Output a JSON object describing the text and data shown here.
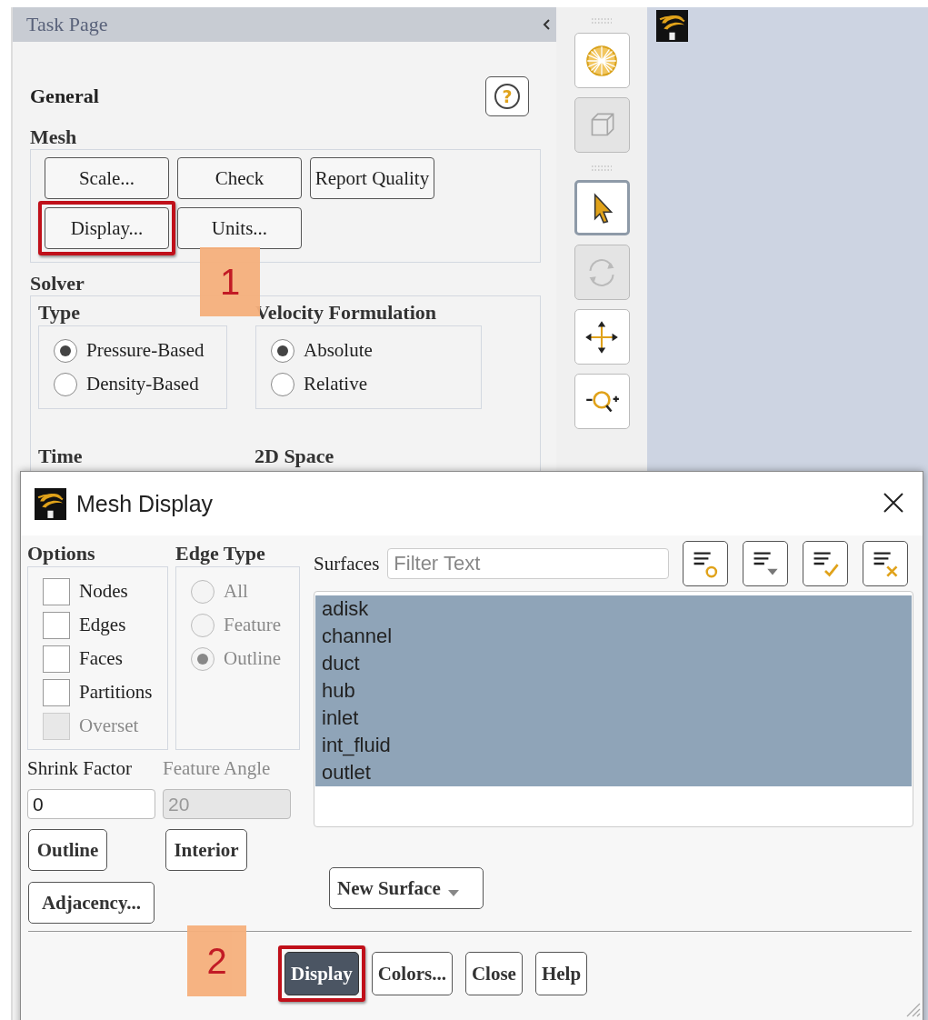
{
  "task_page": {
    "title": "Task Page",
    "heading": "General",
    "help_glyph": "?",
    "mesh": {
      "label": "Mesh",
      "buttons": [
        {
          "label": "Scale...",
          "highlighted": false
        },
        {
          "label": "Check",
          "highlighted": false
        },
        {
          "label": "Report Quality",
          "highlighted": false
        },
        {
          "label": "Display...",
          "highlighted": true
        },
        {
          "label": "Units...",
          "highlighted": false
        }
      ]
    },
    "solver": {
      "label": "Solver",
      "groups": [
        {
          "label": "Type",
          "options": [
            {
              "label": "Pressure-Based",
              "selected": true
            },
            {
              "label": "Density-Based",
              "selected": false
            }
          ]
        },
        {
          "label": "Velocity Formulation",
          "options": [
            {
              "label": "Absolute",
              "selected": true
            },
            {
              "label": "Relative",
              "selected": false
            }
          ]
        }
      ]
    },
    "cut_labels": [
      "Time",
      "2D Space"
    ]
  },
  "toolbar": [
    {
      "kind": "grip"
    },
    {
      "kind": "sphere",
      "disabled": false,
      "selected": false
    },
    {
      "kind": "cube",
      "disabled": true,
      "selected": false
    },
    {
      "kind": "grip"
    },
    {
      "kind": "pointer",
      "disabled": false,
      "selected": true
    },
    {
      "kind": "rotate",
      "disabled": true,
      "selected": false
    },
    {
      "kind": "move",
      "disabled": false,
      "selected": false
    },
    {
      "kind": "zoom",
      "disabled": false,
      "selected": false
    }
  ],
  "dialog": {
    "title": "Mesh Display",
    "options": {
      "label": "Options",
      "items": [
        {
          "label": "Nodes",
          "checked": false,
          "disabled": false
        },
        {
          "label": "Edges",
          "checked": false,
          "disabled": false
        },
        {
          "label": "Faces",
          "checked": false,
          "disabled": false
        },
        {
          "label": "Partitions",
          "checked": false,
          "disabled": false
        },
        {
          "label": "Overset",
          "checked": false,
          "disabled": true
        }
      ]
    },
    "edge_type": {
      "label": "Edge Type",
      "items": [
        {
          "label": "All",
          "selected": false,
          "disabled": true
        },
        {
          "label": "Feature",
          "selected": false,
          "disabled": true
        },
        {
          "label": "Outline",
          "selected": true,
          "disabled": true
        }
      ]
    },
    "fields": [
      {
        "label": "Shrink Factor",
        "value": "0",
        "disabled": false
      },
      {
        "label": "Feature Angle",
        "value": "20",
        "disabled": true
      }
    ],
    "side_buttons": [
      {
        "label": "Outline"
      },
      {
        "label": "Interior"
      },
      {
        "label": "Adjacency..."
      }
    ],
    "surfaces": {
      "label": "Surfaces",
      "placeholder": "Filter Text",
      "tools": [
        {
          "kind": "circle"
        },
        {
          "kind": "caret"
        },
        {
          "kind": "check"
        },
        {
          "kind": "cross"
        }
      ],
      "items": [
        {
          "label": "adisk",
          "selected": true
        },
        {
          "label": "channel",
          "selected": true
        },
        {
          "label": "duct",
          "selected": true
        },
        {
          "label": "hub",
          "selected": true
        },
        {
          "label": "inlet",
          "selected": true
        },
        {
          "label": "int_fluid",
          "selected": true
        },
        {
          "label": "outlet",
          "selected": true
        }
      ]
    },
    "new_surface": {
      "label": "New Surface"
    },
    "actions": [
      {
        "label": "Display",
        "primary": true,
        "highlighted": true
      },
      {
        "label": "Colors...",
        "primary": false,
        "highlighted": false
      },
      {
        "label": "Close",
        "primary": false,
        "highlighted": false
      },
      {
        "label": "Help",
        "primary": false,
        "highlighted": false
      }
    ]
  },
  "callouts": [
    {
      "number": "1"
    },
    {
      "number": "2"
    }
  ]
}
